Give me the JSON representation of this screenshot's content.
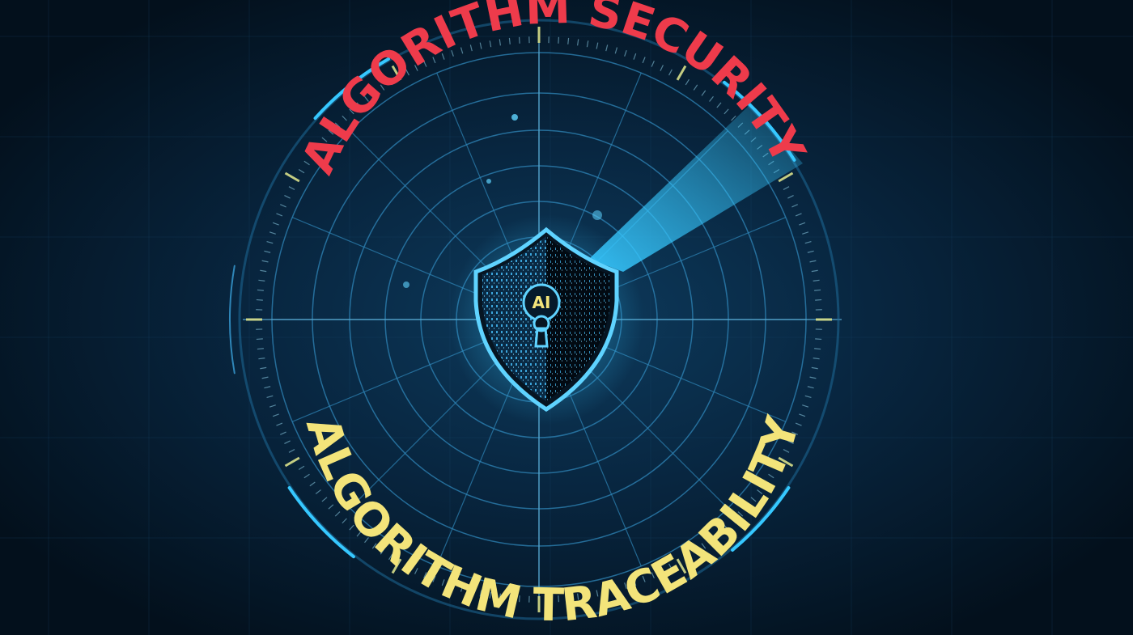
{
  "headline": {
    "top": "ALGORITHM SECURITY",
    "bottom": "ALGORITHM TRACEABILITY"
  },
  "badge": {
    "label": "AI"
  },
  "colors": {
    "background": "#05101d",
    "top_text": "#ee3b4b",
    "bottom_text": "#f3e47a",
    "radar_line": "#2f86b8",
    "accent_cyan": "#36c8ff",
    "tick": "#86c4dc"
  },
  "icons": {
    "center": "shield-keyhole-icon",
    "scan": "radar-sweep-icon"
  }
}
